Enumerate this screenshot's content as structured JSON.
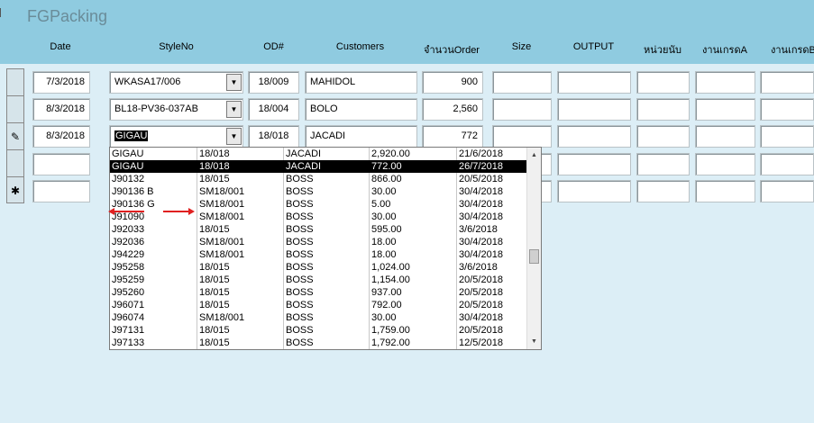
{
  "form": {
    "title": "FGPacking"
  },
  "columns": {
    "date": "Date",
    "styleno": "StyleNo",
    "od": "OD#",
    "customers": "Customers",
    "order_qty": "จำนวนOrder",
    "size": "Size",
    "output": "OUTPUT",
    "unit": "หน่วยนับ",
    "grade_a": "งานเกรดA",
    "grade_b": "งานเกรดB"
  },
  "rows": [
    {
      "date": "7/3/2018",
      "styleno": "WKASA17/006",
      "od": "18/009",
      "customer": "MAHIDOL",
      "order_qty": "900"
    },
    {
      "date": "8/3/2018",
      "styleno": "BL18-PV36-037AB",
      "od": "18/004",
      "customer": "BOLO",
      "order_qty": "2,560"
    },
    {
      "date": "8/3/2018",
      "styleno": "GIGAU",
      "od": "18/018",
      "customer": "JACADI",
      "order_qty": "772"
    }
  ],
  "record_selectors": {
    "editing": "✎",
    "new": "✱"
  },
  "icons": {
    "combo": "dropdown-arrow-icon",
    "scroll_up": "scroll-up-icon",
    "scroll_down": "scroll-down-icon"
  },
  "colors": {
    "header": "#8fcbe0",
    "body": "#dceef6",
    "highlight": "#000000",
    "annotation_arrow": "#e02020"
  },
  "dropdown_list": [
    {
      "style": "GIGAU",
      "od": "18/018",
      "customer": "JACADI",
      "qty": "2,920.00",
      "date": "21/6/2018"
    },
    {
      "style": "GIGAU",
      "od": "18/018",
      "customer": "JACADI",
      "qty": "772.00",
      "date": "26/7/2018",
      "selected": true
    },
    {
      "style": "J90132",
      "od": "18/015",
      "customer": "BOSS",
      "qty": "866.00",
      "date": "20/5/2018"
    },
    {
      "style": "J90136 B",
      "od": "SM18/001",
      "customer": "BOSS",
      "qty": "30.00",
      "date": "30/4/2018"
    },
    {
      "style": "J90136 G",
      "od": "SM18/001",
      "customer": "BOSS",
      "qty": "5.00",
      "date": "30/4/2018"
    },
    {
      "style": "J91090",
      "od": "SM18/001",
      "customer": "BOSS",
      "qty": "30.00",
      "date": "30/4/2018"
    },
    {
      "style": "J92033",
      "od": "18/015",
      "customer": "BOSS",
      "qty": "595.00",
      "date": "3/6/2018"
    },
    {
      "style": "J92036",
      "od": "SM18/001",
      "customer": "BOSS",
      "qty": "18.00",
      "date": "30/4/2018"
    },
    {
      "style": "J94229",
      "od": "SM18/001",
      "customer": "BOSS",
      "qty": "18.00",
      "date": "30/4/2018"
    },
    {
      "style": "J95258",
      "od": "18/015",
      "customer": "BOSS",
      "qty": "1,024.00",
      "date": "3/6/2018"
    },
    {
      "style": "J95259",
      "od": "18/015",
      "customer": "BOSS",
      "qty": "1,154.00",
      "date": "20/5/2018"
    },
    {
      "style": "J95260",
      "od": "18/015",
      "customer": "BOSS",
      "qty": "937.00",
      "date": "20/5/2018"
    },
    {
      "style": "J96071",
      "od": "18/015",
      "customer": "BOSS",
      "qty": "792.00",
      "date": "20/5/2018"
    },
    {
      "style": "J96074",
      "od": "SM18/001",
      "customer": "BOSS",
      "qty": "30.00",
      "date": "30/4/2018"
    },
    {
      "style": "J97131",
      "od": "18/015",
      "customer": "BOSS",
      "qty": "1,759.00",
      "date": "20/5/2018"
    },
    {
      "style": "J97133",
      "od": "18/015",
      "customer": "BOSS",
      "qty": "1,792.00",
      "date": "12/5/2018"
    }
  ]
}
